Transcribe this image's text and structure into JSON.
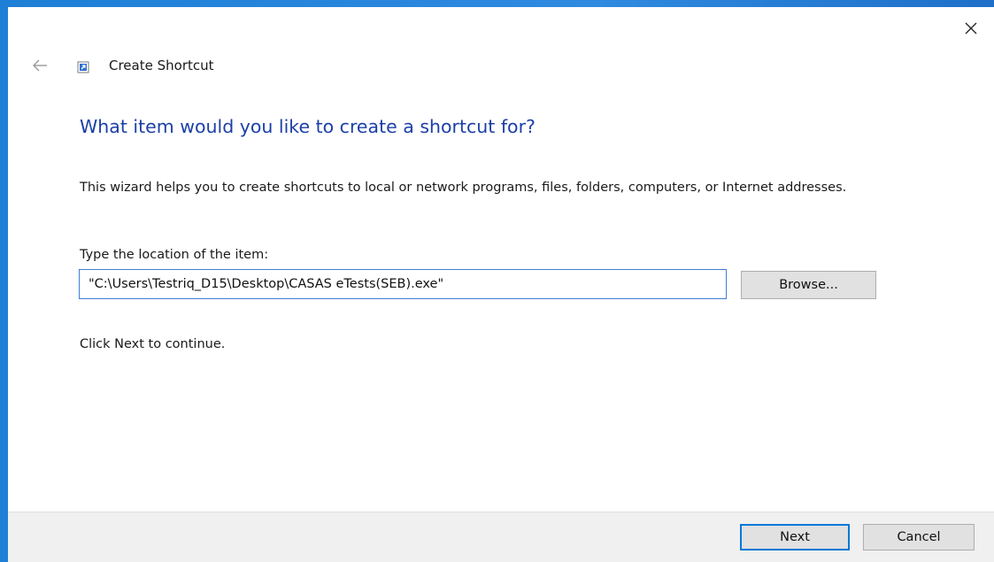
{
  "window": {
    "accent_color": "#1e7fd6",
    "close_icon": "close-icon"
  },
  "header": {
    "back_icon": "back-arrow-icon",
    "wizard_icon": "shortcut-icon",
    "title": "Create Shortcut"
  },
  "main": {
    "heading": "What item would you like to create a shortcut for?",
    "heading_color": "#1c3fa8",
    "description": "This wizard helps you to create shortcuts to local or network programs, files, folders, computers, or Internet addresses.",
    "location_label": "Type the location of the item:",
    "location_value": "\"C:\\Users\\Testriq_D15\\Desktop\\CASAS eTests(SEB).exe\"",
    "browse_label": "Browse...",
    "hint": "Click Next to continue."
  },
  "footer": {
    "next_label": "Next",
    "cancel_label": "Cancel"
  }
}
